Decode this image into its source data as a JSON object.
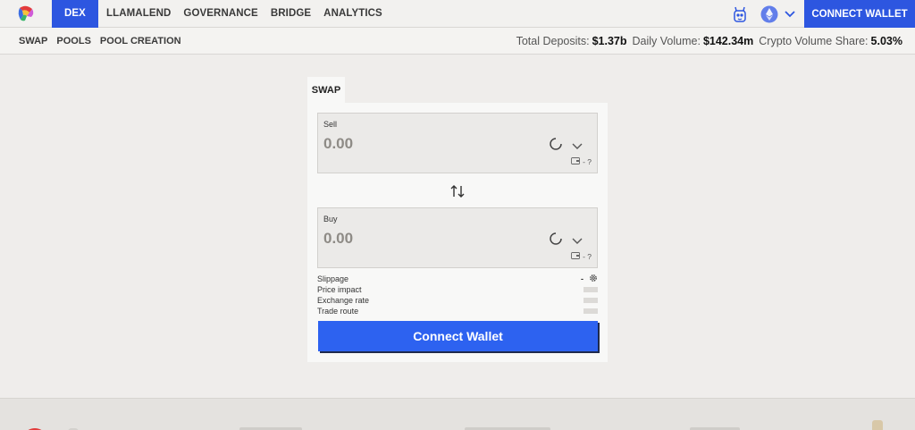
{
  "nav": {
    "items": [
      {
        "label": "DEX",
        "active": true
      },
      {
        "label": "LLAMALEND"
      },
      {
        "label": "GOVERNANCE"
      },
      {
        "label": "BRIDGE"
      },
      {
        "label": "ANALYTICS"
      }
    ],
    "connect_wallet": "CONNECT WALLET",
    "icons": [
      "curve-logo-icon",
      "llama-icon",
      "ethereum-icon",
      "chevron-down-icon"
    ]
  },
  "subnav": {
    "items": [
      "SWAP",
      "POOLS",
      "POOL CREATION"
    ],
    "stats": [
      {
        "label": "Total Deposits:",
        "value": "$1.37b"
      },
      {
        "label": "Daily Volume:",
        "value": "$142.34m"
      },
      {
        "label": "Crypto Volume Share:",
        "value": "5.03%"
      }
    ]
  },
  "swap": {
    "tab_label": "SWAP",
    "sell": {
      "label": "Sell",
      "amount": "0.00",
      "balance": "- ?"
    },
    "buy": {
      "label": "Buy",
      "amount": "0.00",
      "balance": "- ?"
    },
    "details": {
      "slippage_label": "Slippage",
      "slippage_value": "-",
      "price_impact_label": "Price impact",
      "exchange_rate_label": "Exchange rate",
      "trade_route_label": "Trade route"
    },
    "connect_button": "Connect Wallet"
  },
  "colors": {
    "accent": "#2d56e0",
    "button": "#2d62f0",
    "background": "#efedeb",
    "card": "#f8f8f7"
  }
}
